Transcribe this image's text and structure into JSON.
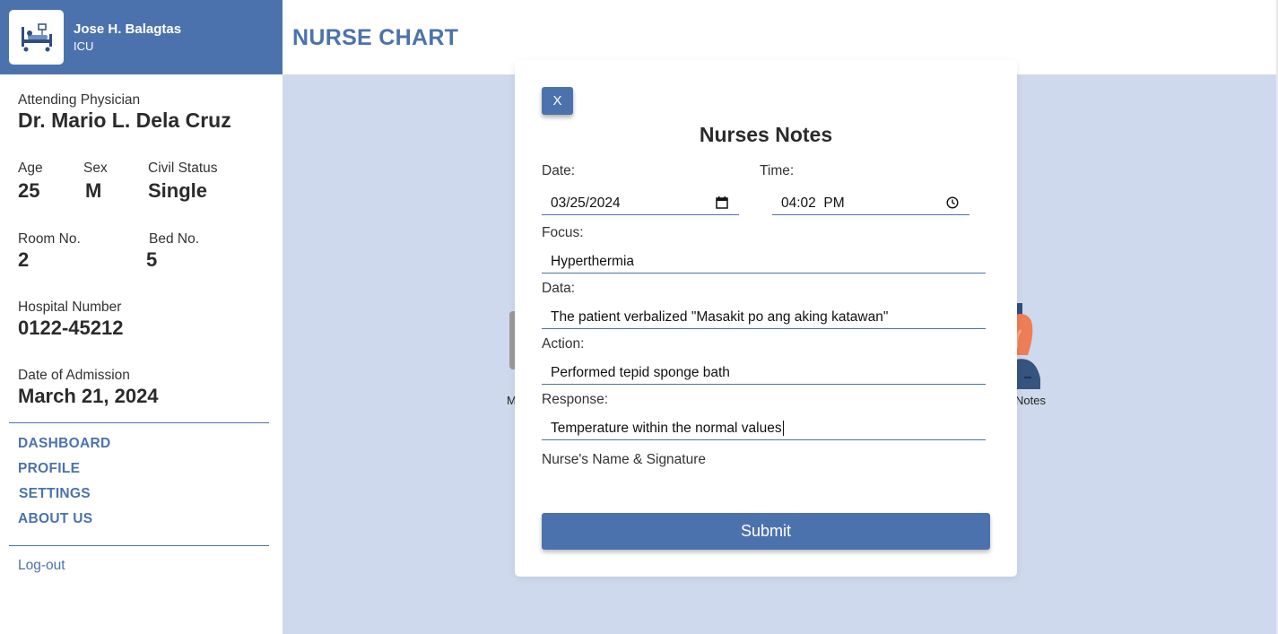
{
  "patient": {
    "name": "Jose H. Balagtas",
    "unit": "ICU",
    "attending_label": "Attending Physician",
    "attending": "Dr. Mario L. Dela Cruz",
    "age_label": "Age",
    "age": "25",
    "sex_label": "Sex",
    "sex": "M",
    "civil_label": "Civil Status",
    "civil": "Single",
    "room_label": "Room No.",
    "room": "2",
    "bed_label": "Bed No.",
    "bed": "5",
    "hospital_label": "Hospital Number",
    "hospital": "0122-45212",
    "admission_label": "Date of Admission",
    "admission": "March 21, 2024"
  },
  "nav": {
    "dashboard": "DASHBOARD",
    "profile": "PROFILE",
    "settings": "SETTINGS",
    "about": "ABOUT US",
    "logout": "Log-out"
  },
  "header": {
    "title": "NURSE CHART"
  },
  "background": {
    "left_label": "M",
    "right_label": "Notes"
  },
  "modal": {
    "close_label": "X",
    "title": "Nurses Notes",
    "date_label": "Date:",
    "date_value": "03/25/2024",
    "time_label": "Time:",
    "time_value": "04:02  PM",
    "focus_label": "Focus:",
    "focus_value": "Hyperthermia",
    "data_label": "Data:",
    "data_value": "The patient verbalized \"Masakit po ang aking katawan\"",
    "action_label": "Action:",
    "action_value": "Performed tepid sponge bath",
    "response_label": "Response:",
    "response_value": "Temperature within the normal values",
    "signature_label": "Nurse's Name & Signature",
    "submit_label": "Submit"
  },
  "icons": {
    "logo": "hospital-bed-icon",
    "calendar": "calendar-icon",
    "clock": "clock-icon",
    "nurse": "nurse-figure-icon"
  },
  "colors": {
    "accent": "#4c72ae",
    "main_bg": "#cfd9ed"
  }
}
